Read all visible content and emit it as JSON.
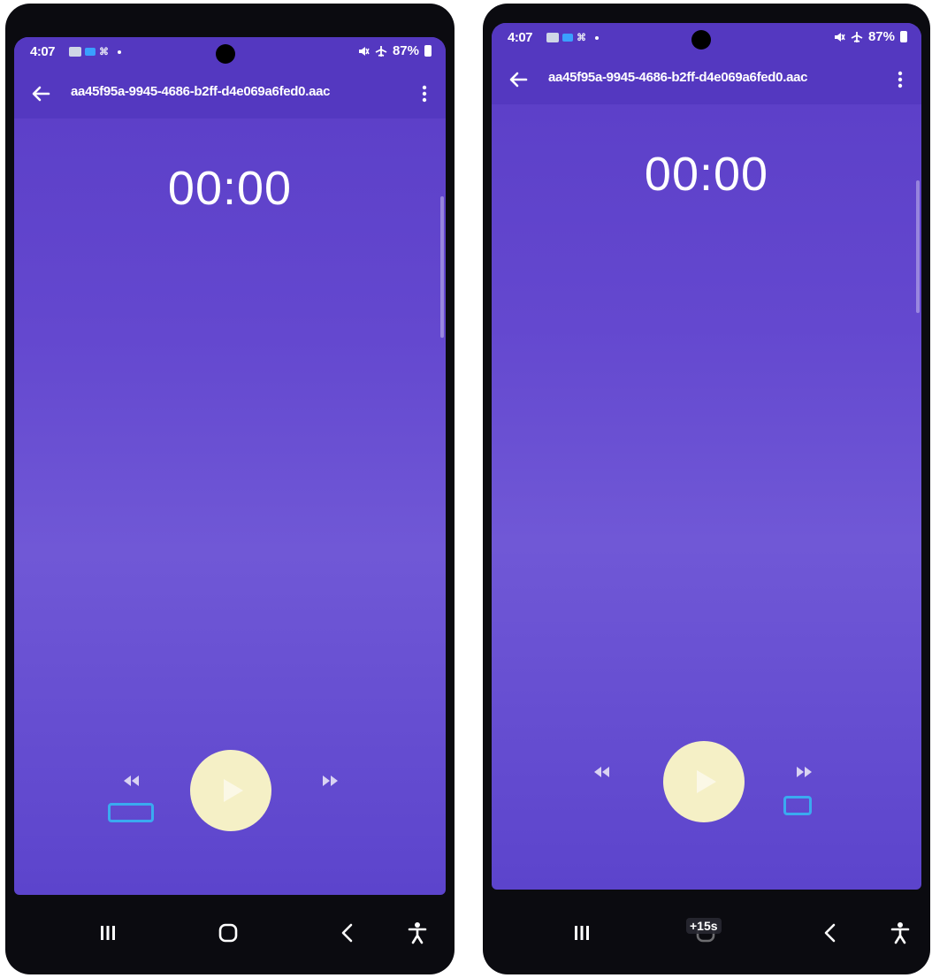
{
  "status_bar": {
    "time": "4:07",
    "battery": "87%"
  },
  "app_bar": {
    "file_title": "aa45f95a-9945-4686-b2ff-d4e069a6fed0.aac"
  },
  "player": {
    "elapsed": "00:00"
  },
  "nav_bar": {
    "toast": "+15s"
  },
  "colors": {
    "background": "#6448cf",
    "app_bar": "#5438c0",
    "play_button": "#f5f0c6",
    "focus_highlight": "#3aaaf0"
  },
  "icons": [
    "back-arrow-icon",
    "more-vert-icon",
    "rewind-icon",
    "play-icon",
    "fast-forward-icon",
    "recents-icon",
    "home-icon",
    "nav-back-icon",
    "accessibility-icon",
    "mute-icon",
    "airplane-icon",
    "battery-icon"
  ]
}
